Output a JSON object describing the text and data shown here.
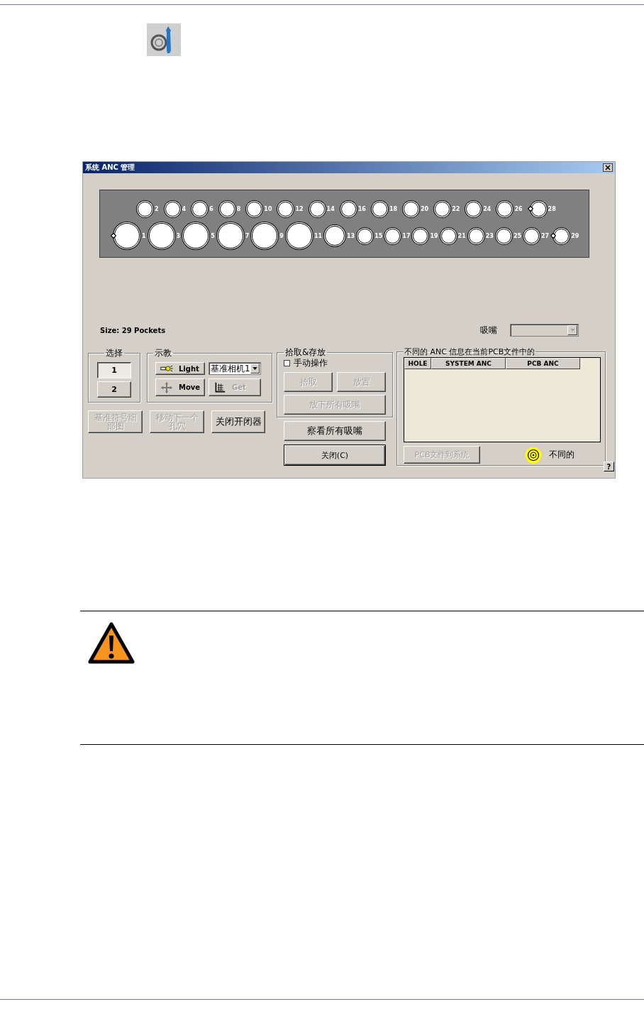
{
  "dialog": {
    "title": "系统 ANC 管理",
    "pockets": {
      "top": [
        {
          "label": "2",
          "kind": "small",
          "marked": false
        },
        {
          "label": "4",
          "kind": "small",
          "marked": false
        },
        {
          "label": "6",
          "kind": "small",
          "marked": false
        },
        {
          "label": "8",
          "kind": "small",
          "marked": false
        },
        {
          "label": "10",
          "kind": "small",
          "marked": false
        },
        {
          "label": "12",
          "kind": "small",
          "marked": false
        },
        {
          "label": "14",
          "kind": "small",
          "marked": false
        },
        {
          "label": "16",
          "kind": "small",
          "marked": false
        },
        {
          "label": "18",
          "kind": "small",
          "marked": false
        },
        {
          "label": "20",
          "kind": "small",
          "marked": false
        },
        {
          "label": "22",
          "kind": "small",
          "marked": false
        },
        {
          "label": "24",
          "kind": "small",
          "marked": false
        },
        {
          "label": "26",
          "kind": "small",
          "marked": false
        },
        {
          "label": "28",
          "kind": "small",
          "marked": true
        }
      ],
      "bottom": [
        {
          "label": "1",
          "kind": "large",
          "marked": true
        },
        {
          "label": "3",
          "kind": "large",
          "marked": false
        },
        {
          "label": "5",
          "kind": "large",
          "marked": false
        },
        {
          "label": "7",
          "kind": "large",
          "marked": false
        },
        {
          "label": "9",
          "kind": "large",
          "marked": false
        },
        {
          "label": "11",
          "kind": "large",
          "marked": false
        },
        {
          "label": "13",
          "kind": "medium",
          "marked": false
        },
        {
          "label": "15",
          "kind": "small",
          "marked": false
        },
        {
          "label": "17",
          "kind": "small",
          "marked": false
        },
        {
          "label": "19",
          "kind": "small",
          "marked": false
        },
        {
          "label": "21",
          "kind": "small",
          "marked": false
        },
        {
          "label": "23",
          "kind": "small",
          "marked": false
        },
        {
          "label": "25",
          "kind": "small",
          "marked": false
        },
        {
          "label": "27",
          "kind": "small",
          "marked": false
        },
        {
          "label": "29",
          "kind": "small",
          "marked": true
        }
      ]
    },
    "size_label": "Size: 29 Pockets",
    "nozzle": {
      "label": "吸嘴",
      "disabled": true
    },
    "select_group": {
      "title": "选择",
      "buttons": [
        {
          "label": "1",
          "selected": true
        },
        {
          "label": "2",
          "selected": false
        }
      ]
    },
    "teach_group": {
      "title": "示教",
      "camera": "基准相机1",
      "buttons": [
        {
          "label": "Light",
          "kind": "light",
          "disabled": false
        },
        {
          "label": "Move",
          "kind": "move",
          "disabled": false
        },
        {
          "label": "Get",
          "kind": "get",
          "disabled": true
        }
      ]
    },
    "lower_buttons": [
      {
        "label": "基准符号细部图",
        "disabled": true
      },
      {
        "label": "移动下一个孔穴",
        "disabled": true
      },
      {
        "label": "关闭开闭器",
        "disabled": false
      }
    ],
    "pick_group": {
      "title": "拾取&存放",
      "manual": {
        "label": "手动操作",
        "checked": false
      },
      "buttons": [
        {
          "label": "拾取",
          "disabled": true
        },
        {
          "label": "放置",
          "disabled": true
        },
        {
          "label": "放下所有吸嘴",
          "disabled": true
        }
      ]
    },
    "view_button": {
      "label": "察看所有吸嘴",
      "disabled": false
    },
    "close_button": {
      "label": "关闭(C)",
      "disabled": false
    },
    "diff_group": {
      "title": "不同的 ANC 信息在当前PCB文件中的",
      "columns": [
        "HOLE",
        "SYSTEM ANC",
        "PCB ANC"
      ],
      "transfer_button": {
        "label": "PCB文件到系统",
        "disabled": true
      },
      "legend": "不同的"
    },
    "help": "?"
  }
}
